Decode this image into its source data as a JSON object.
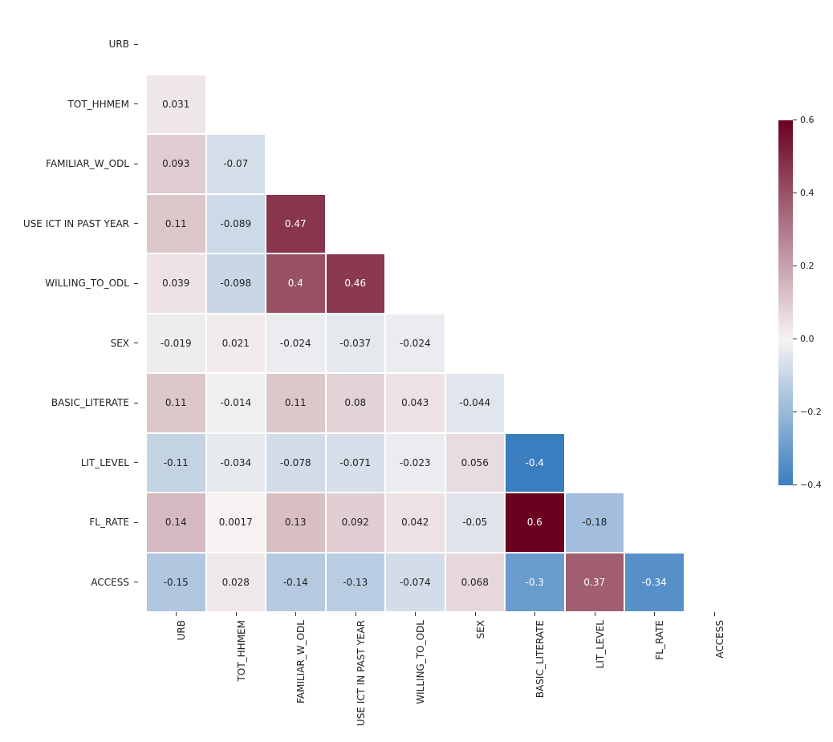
{
  "chart_data": {
    "type": "heatmap",
    "labels": [
      "URB",
      "TOT_HHMEM",
      "FAMILIAR_W_ODL",
      "USE ICT IN PAST YEAR",
      "WILLING_TO_ODL",
      "SEX",
      "BASIC_LITERATE",
      "LIT_LEVEL",
      "FL_RATE",
      "ACCESS"
    ],
    "vmin": -0.4,
    "vmax": 0.6,
    "matrix": [
      [
        null,
        null,
        null,
        null,
        null,
        null,
        null,
        null,
        null,
        null
      ],
      [
        0.031,
        null,
        null,
        null,
        null,
        null,
        null,
        null,
        null,
        null
      ],
      [
        0.093,
        -0.07,
        null,
        null,
        null,
        null,
        null,
        null,
        null,
        null
      ],
      [
        0.11,
        -0.089,
        0.47,
        null,
        null,
        null,
        null,
        null,
        null,
        null
      ],
      [
        0.039,
        -0.098,
        0.4,
        0.46,
        null,
        null,
        null,
        null,
        null,
        null
      ],
      [
        -0.019,
        0.021,
        -0.024,
        -0.037,
        -0.024,
        null,
        null,
        null,
        null,
        null
      ],
      [
        0.11,
        -0.014,
        0.11,
        0.08,
        0.043,
        -0.044,
        null,
        null,
        null,
        null
      ],
      [
        -0.11,
        -0.034,
        -0.078,
        -0.071,
        -0.023,
        0.056,
        -0.4,
        null,
        null,
        null
      ],
      [
        0.14,
        0.0017,
        0.13,
        0.092,
        0.042,
        -0.05,
        0.6,
        -0.18,
        null,
        null
      ],
      [
        -0.15,
        0.028,
        -0.14,
        -0.13,
        -0.074,
        0.068,
        -0.3,
        0.37,
        -0.34,
        null
      ]
    ],
    "display": [
      [
        null,
        null,
        null,
        null,
        null,
        null,
        null,
        null,
        null,
        null
      ],
      [
        "0.031",
        null,
        null,
        null,
        null,
        null,
        null,
        null,
        null,
        null
      ],
      [
        "0.093",
        "-0.07",
        null,
        null,
        null,
        null,
        null,
        null,
        null,
        null
      ],
      [
        "0.11",
        "-0.089",
        "0.47",
        null,
        null,
        null,
        null,
        null,
        null,
        null
      ],
      [
        "0.039",
        "-0.098",
        "0.4",
        "0.46",
        null,
        null,
        null,
        null,
        null,
        null
      ],
      [
        "-0.019",
        "0.021",
        "-0.024",
        "-0.037",
        "-0.024",
        null,
        null,
        null,
        null,
        null
      ],
      [
        "0.11",
        "-0.014",
        "0.11",
        "0.08",
        "0.043",
        "-0.044",
        null,
        null,
        null,
        null
      ],
      [
        "-0.11",
        "-0.034",
        "-0.078",
        "-0.071",
        "-0.023",
        "0.056",
        "-0.4",
        null,
        null,
        null
      ],
      [
        "0.14",
        "0.0017",
        "0.13",
        "0.092",
        "0.042",
        "-0.05",
        "0.6",
        "-0.18",
        null,
        null
      ],
      [
        "-0.15",
        "0.028",
        "-0.14",
        "-0.13",
        "-0.074",
        "0.068",
        "-0.3",
        "0.37",
        "-0.34",
        null
      ]
    ],
    "colorbar_ticks": [
      -0.4,
      -0.2,
      0.0,
      0.2,
      0.4,
      0.6
    ],
    "colorbar_tick_labels": [
      "−0.4",
      "−0.2",
      "0.0",
      "0.2",
      "0.4",
      "0.6"
    ]
  }
}
